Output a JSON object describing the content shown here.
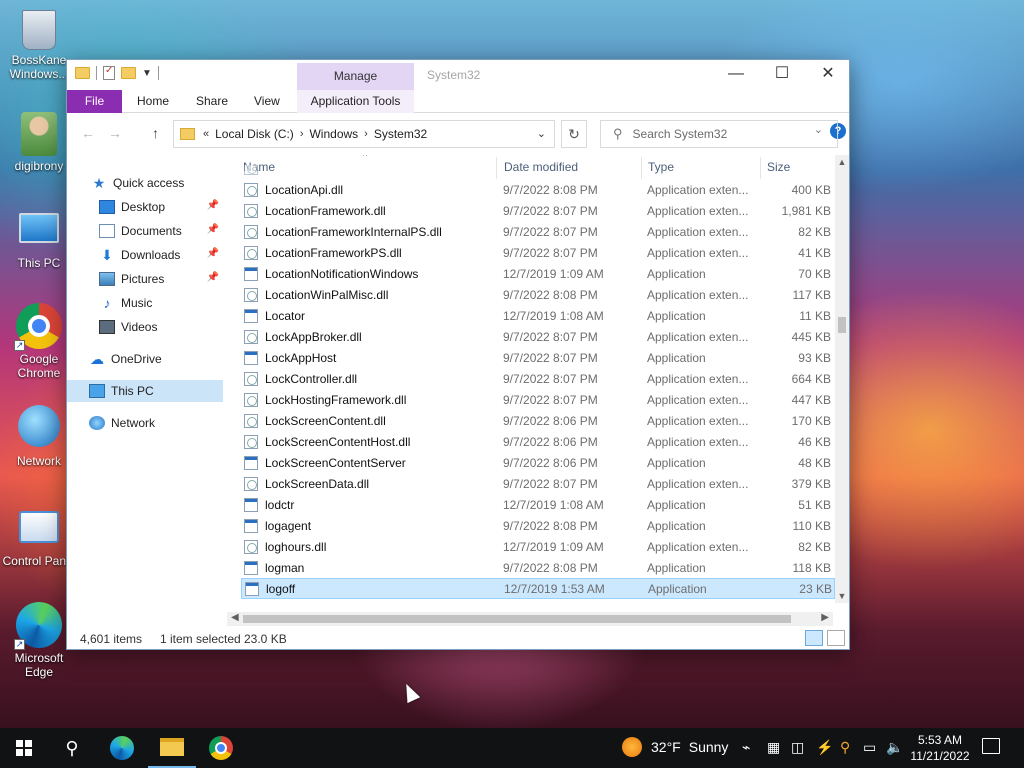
{
  "desktop": {
    "icons": [
      {
        "label": "BossKane Windows...",
        "icon": "recycle-bin-icon"
      },
      {
        "label": "digibrony",
        "icon": "user-folder-icon"
      },
      {
        "label": "This PC",
        "icon": "this-pc-icon"
      },
      {
        "label": "Google Chrome",
        "icon": "chrome-icon"
      },
      {
        "label": "Network",
        "icon": "network-icon"
      },
      {
        "label": "Control Panel",
        "icon": "control-panel-icon"
      },
      {
        "label": "Microsoft Edge",
        "icon": "edge-icon"
      }
    ]
  },
  "window": {
    "title": "System32",
    "contextual_tab": "Manage",
    "ribbon_tabs": [
      "File",
      "Home",
      "Share",
      "View",
      "Application Tools"
    ],
    "controls": {
      "minimize": "—",
      "maximize": "☐",
      "close": "✕"
    },
    "help": "?"
  },
  "address": {
    "overflow": "«",
    "crumbs": [
      "Local Disk (C:)",
      "Windows",
      "System32"
    ],
    "search_placeholder": "Search System32"
  },
  "nav": {
    "items": [
      {
        "label": "Quick access",
        "icon": "star-icon",
        "pinned": false
      },
      {
        "label": "Desktop",
        "icon": "desktop-icon",
        "pinned": true
      },
      {
        "label": "Documents",
        "icon": "documents-icon",
        "pinned": true
      },
      {
        "label": "Downloads",
        "icon": "downloads-icon",
        "pinned": true
      },
      {
        "label": "Pictures",
        "icon": "pictures-icon",
        "pinned": true
      },
      {
        "label": "Music",
        "icon": "music-icon",
        "pinned": false
      },
      {
        "label": "Videos",
        "icon": "videos-icon",
        "pinned": false
      },
      {
        "label": "OneDrive",
        "icon": "onedrive-icon",
        "pinned": false
      },
      {
        "label": "This PC",
        "icon": "this-pc-icon",
        "pinned": false
      },
      {
        "label": "Network",
        "icon": "network-icon",
        "pinned": false
      }
    ]
  },
  "columns": {
    "name": "Name",
    "date": "Date modified",
    "type": "Type",
    "size": "Size"
  },
  "files": [
    {
      "name": "LocationApi.dll",
      "date": "9/7/2022 8:08 PM",
      "type": "Application exten...",
      "size": "400 KB",
      "kind": "dll"
    },
    {
      "name": "LocationFramework.dll",
      "date": "9/7/2022 8:07 PM",
      "type": "Application exten...",
      "size": "1,981 KB",
      "kind": "dll"
    },
    {
      "name": "LocationFrameworkInternalPS.dll",
      "date": "9/7/2022 8:07 PM",
      "type": "Application exten...",
      "size": "82 KB",
      "kind": "dll"
    },
    {
      "name": "LocationFrameworkPS.dll",
      "date": "9/7/2022 8:07 PM",
      "type": "Application exten...",
      "size": "41 KB",
      "kind": "dll"
    },
    {
      "name": "LocationNotificationWindows",
      "date": "12/7/2019 1:09 AM",
      "type": "Application",
      "size": "70 KB",
      "kind": "app"
    },
    {
      "name": "LocationWinPalMisc.dll",
      "date": "9/7/2022 8:08 PM",
      "type": "Application exten...",
      "size": "117 KB",
      "kind": "dll"
    },
    {
      "name": "Locator",
      "date": "12/7/2019 1:08 AM",
      "type": "Application",
      "size": "11 KB",
      "kind": "app"
    },
    {
      "name": "LockAppBroker.dll",
      "date": "9/7/2022 8:07 PM",
      "type": "Application exten...",
      "size": "445 KB",
      "kind": "dll"
    },
    {
      "name": "LockAppHost",
      "date": "9/7/2022 8:07 PM",
      "type": "Application",
      "size": "93 KB",
      "kind": "app"
    },
    {
      "name": "LockController.dll",
      "date": "9/7/2022 8:07 PM",
      "type": "Application exten...",
      "size": "664 KB",
      "kind": "dll"
    },
    {
      "name": "LockHostingFramework.dll",
      "date": "9/7/2022 8:07 PM",
      "type": "Application exten...",
      "size": "447 KB",
      "kind": "dll"
    },
    {
      "name": "LockScreenContent.dll",
      "date": "9/7/2022 8:06 PM",
      "type": "Application exten...",
      "size": "170 KB",
      "kind": "dll"
    },
    {
      "name": "LockScreenContentHost.dll",
      "date": "9/7/2022 8:06 PM",
      "type": "Application exten...",
      "size": "46 KB",
      "kind": "dll"
    },
    {
      "name": "LockScreenContentServer",
      "date": "9/7/2022 8:06 PM",
      "type": "Application",
      "size": "48 KB",
      "kind": "app"
    },
    {
      "name": "LockScreenData.dll",
      "date": "9/7/2022 8:07 PM",
      "type": "Application exten...",
      "size": "379 KB",
      "kind": "dll"
    },
    {
      "name": "lodctr",
      "date": "12/7/2019 1:08 AM",
      "type": "Application",
      "size": "51 KB",
      "kind": "app"
    },
    {
      "name": "logagent",
      "date": "9/7/2022 8:08 PM",
      "type": "Application",
      "size": "110 KB",
      "kind": "app"
    },
    {
      "name": "loghours.dll",
      "date": "12/7/2019 1:09 AM",
      "type": "Application exten...",
      "size": "82 KB",
      "kind": "dll"
    },
    {
      "name": "logman",
      "date": "9/7/2022 8:08 PM",
      "type": "Application",
      "size": "118 KB",
      "kind": "app"
    },
    {
      "name": "logoff",
      "date": "12/7/2019 1:53 AM",
      "type": "Application",
      "size": "23 KB",
      "kind": "app",
      "selected": true
    }
  ],
  "status": {
    "items": "4,601 items",
    "selected": "1 item selected",
    "size": "23.0 KB"
  },
  "taskbar": {
    "weather_temp": "32°F",
    "weather_desc": "Sunny",
    "time": "5:53 AM",
    "date": "11/21/2022",
    "pinned": [
      "start-icon",
      "search-icon",
      "edge-icon",
      "file-explorer-icon",
      "chrome-icon"
    ]
  }
}
